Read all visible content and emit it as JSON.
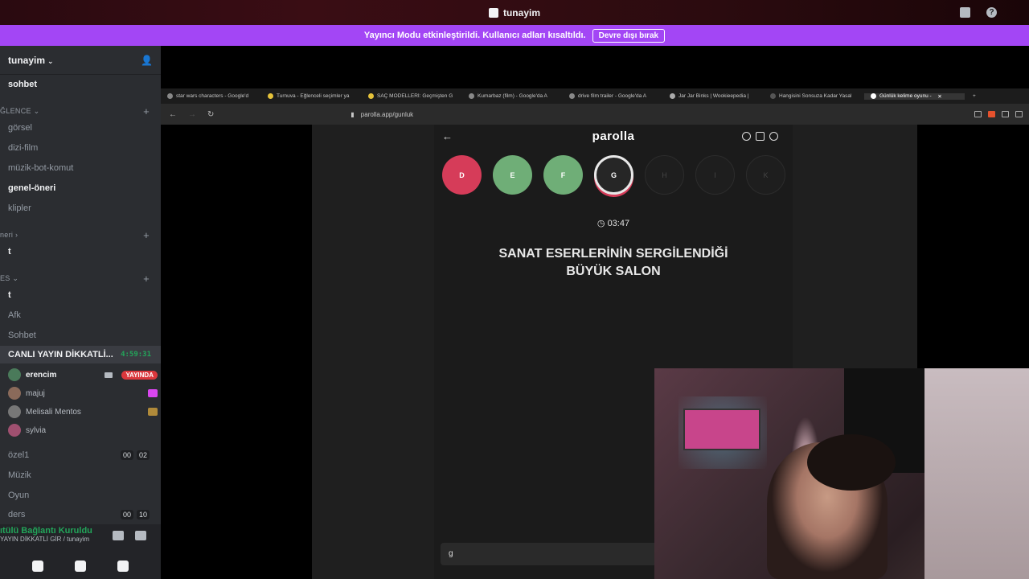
{
  "window": {
    "title": "tunayim"
  },
  "banner": {
    "text": "Yayıncı Modu etkinleştirildi. Kullanıcı adları kısaltıldı.",
    "button": "Devre dışı bırak"
  },
  "sidebar": {
    "server_name": "tunayim",
    "channels_top": [
      "sohbet"
    ],
    "cat_eglence": "ĞLENCE",
    "eglence_channels": [
      "görsel",
      "dizi-film",
      "müzik-bot-komut",
      "genel-öneri",
      "klipler"
    ],
    "cat_oneri": "neri",
    "oneri_channels": [
      "t"
    ],
    "cat_es": "ES",
    "es_channels": [
      "t",
      "Afk",
      "Sohbet"
    ],
    "live_channel": {
      "name": "CANLI YAYIN DİKKATLİ...",
      "time": "4:59:31"
    },
    "users": [
      {
        "name": "erencim",
        "badge": "YAYINDA"
      },
      {
        "name": "majuj"
      },
      {
        "name": "Melisali Mentos"
      },
      {
        "name": "sylvia"
      }
    ],
    "voice_channels": [
      {
        "name": "özel1",
        "c1": "00",
        "c2": "02"
      },
      {
        "name": "Müzik"
      },
      {
        "name": "Oyun"
      },
      {
        "name": "ders",
        "c1": "00",
        "c2": "10"
      }
    ],
    "voice_status": {
      "line1": "ıtülü Bağlantı Kuruldu",
      "line2": "YAYIN DİKKATLİ GİR / tunayim"
    }
  },
  "browser": {
    "tabs": [
      "star wars characters - Google'd",
      "Turnuva - Eğlenceli seçimler ya",
      "SAÇ MODELLERİ: Geçmişten G",
      "Kumarbaz (film) - Google'da A",
      "drive film trailer - Google'da A",
      "Jar Jar Binks | Wookieepedia |",
      "Hangisini Sonsuza Kadar Yasal",
      "Günlük kelime oyunu -"
    ],
    "url": "parolla.app/gunluk"
  },
  "game": {
    "brand": "parolla",
    "letters": [
      {
        "l": "D",
        "state": "wrong"
      },
      {
        "l": "E",
        "state": "right"
      },
      {
        "l": "F",
        "state": "right"
      },
      {
        "l": "G",
        "state": "current"
      },
      {
        "l": "H",
        "state": "pending"
      },
      {
        "l": "I",
        "state": "pending"
      },
      {
        "l": "K",
        "state": "pending"
      }
    ],
    "timer": "03:47",
    "question_line1": "SANAT ESERLERİNİN SERGİLENDİĞİ",
    "question_line2": "BÜYÜK SALON",
    "answer_value": "g"
  },
  "colors": {
    "banner": "#a346f5",
    "wrong": "#d63c59",
    "right": "#6fae77",
    "live_green": "#23a55a"
  }
}
